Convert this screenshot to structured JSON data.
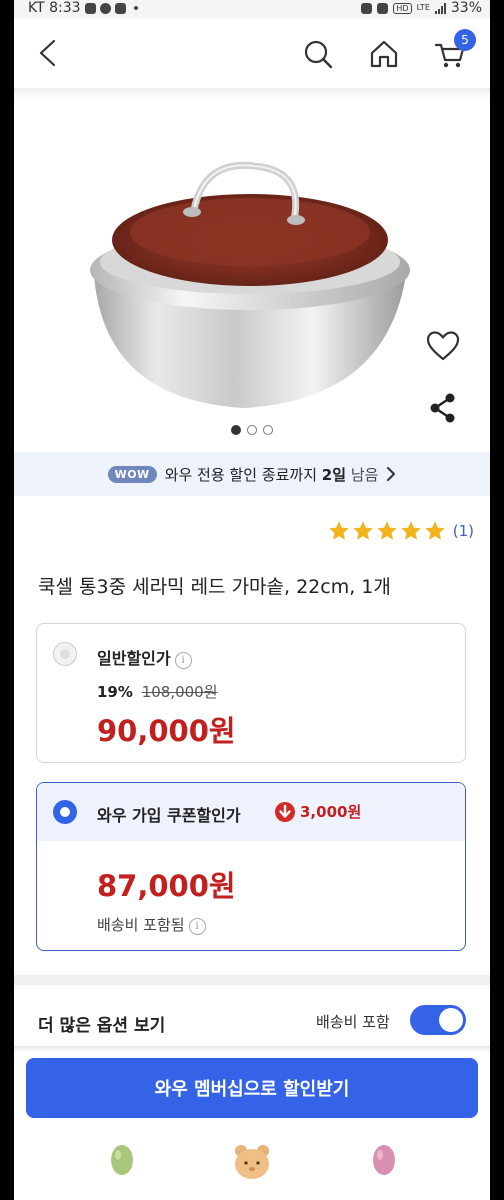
{
  "status": {
    "carrier_time": "KT 8:33",
    "battery": "33%",
    "hd": "HD",
    "lte": "LTE"
  },
  "nav": {
    "cart_count": "5"
  },
  "product": {
    "title": "쿡셀 통3중 세라믹 레드 가마솥, 22cm, 1개",
    "image_pages": 3,
    "image_active_page": 1,
    "rating_stars": 5,
    "rating_count": "(1)"
  },
  "wow_banner": {
    "badge": "WOW",
    "text": "와우 전용 할인 종료까지",
    "remaining": "2일",
    "suffix": "남음"
  },
  "options": [
    {
      "label": "일반할인가",
      "discount_pct": "19%",
      "original_price": "108,000원",
      "price": "90,000원",
      "selected": false
    },
    {
      "label": "와우 가입 쿠폰할인가",
      "coupon_amount": "3,000원",
      "price": "87,000원",
      "shipping_note": "배송비 포함됨",
      "selected": true
    }
  ],
  "more_options": {
    "label": "더 많은 옵션 보기",
    "shipping_toggle_label": "배송비 포함",
    "shipping_toggle_on": true
  },
  "cta": {
    "label": "와우 멤버십으로 할인받기"
  },
  "colors": {
    "accent": "#3463e8",
    "price_red": "#c21f1f",
    "star": "#f2b21c"
  }
}
